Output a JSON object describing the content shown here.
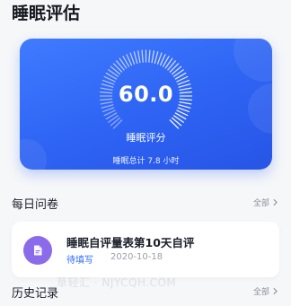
{
  "page": {
    "title": "睡眠评估"
  },
  "score_card": {
    "score": "60.0",
    "score_label": "睡眠评分",
    "total_text": "睡眠总计 7.8 小时"
  },
  "questionnaire": {
    "section_title": "每日问卷",
    "more_label": "全部",
    "item": {
      "title": "睡眠自评量表第10天自评",
      "status": "待填写",
      "date": "2020-10-18",
      "icon": "document-icon"
    }
  },
  "history": {
    "section_title": "历史记录",
    "more_label": "全部"
  },
  "watermark": "草轻汇 · NJYCQH.COM",
  "colors": {
    "accent": "#2f6cf6",
    "card_gradient_start": "#3f7bff",
    "card_gradient_end": "#2755e6",
    "icon_bg": "#8b6be9"
  }
}
